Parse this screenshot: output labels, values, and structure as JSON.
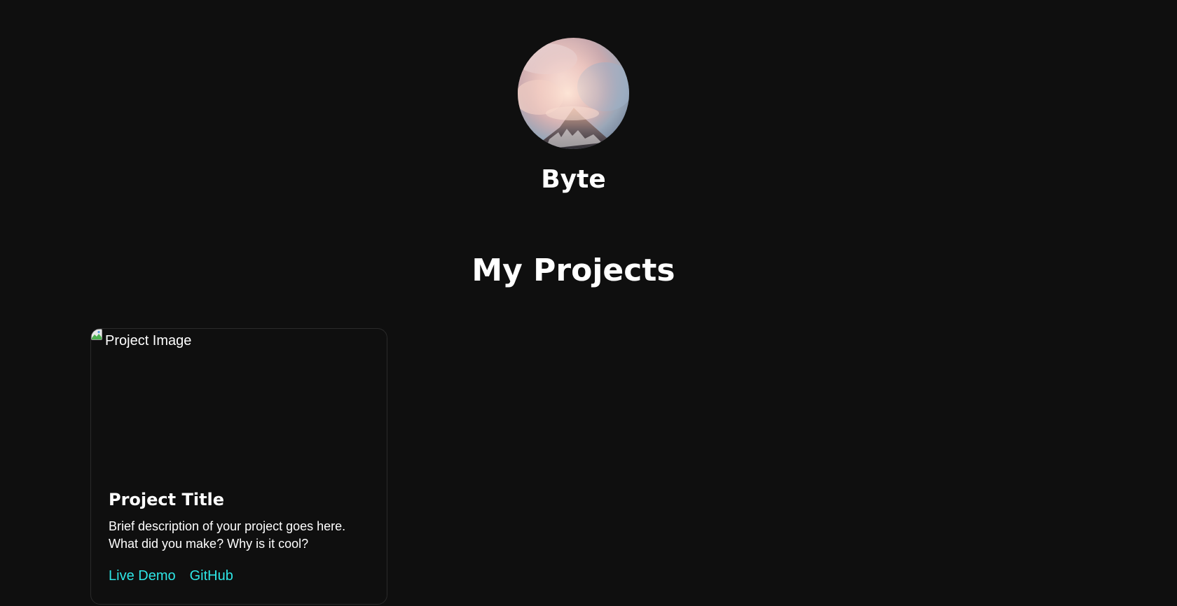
{
  "profile": {
    "name": "Byte"
  },
  "projects_section": {
    "title": "My Projects",
    "cards": [
      {
        "image_alt": "Project Image",
        "title": "Project Title",
        "description_line1": "Brief description of your project goes here.",
        "description_line2": "What did you make? Why is it cool?",
        "live_demo_label": "Live Demo",
        "github_label": "GitHub"
      }
    ]
  },
  "colors": {
    "background": "#0f0f0f",
    "text": "#ffffff",
    "link": "#2ee6e6",
    "card_border": "#2a2a2a"
  }
}
